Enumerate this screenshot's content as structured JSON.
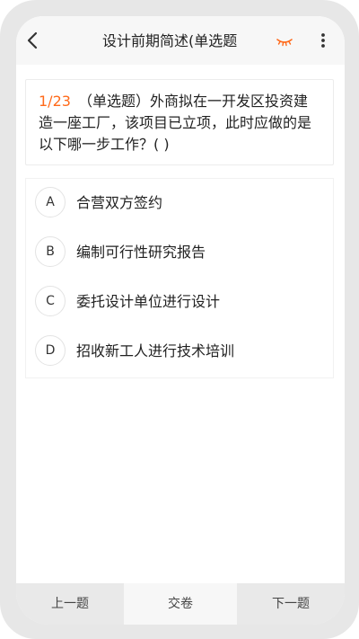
{
  "header": {
    "title": "设计前期简述(单选题",
    "back_icon": "chevron-left-icon",
    "eye_icon": "closed-eye-icon",
    "more_icon": "vertical-ellipsis-icon"
  },
  "question": {
    "index": "1/23",
    "text": "（单选题）外商拟在一开发区投资建造一座工厂，该项目已立项，此时应做的是以下哪一步工作？( )"
  },
  "options": [
    {
      "letter": "A",
      "text": "合营双方签约"
    },
    {
      "letter": "B",
      "text": "编制可行性研究报告"
    },
    {
      "letter": "C",
      "text": "委托设计单位进行设计"
    },
    {
      "letter": "D",
      "text": "招收新工人进行技术培训"
    }
  ],
  "footer": {
    "prev_label": "上一题",
    "submit_label": "交卷",
    "next_label": "下一题"
  },
  "colors": {
    "accent": "#ff6a1a",
    "frame": "#e7e7e7",
    "bar": "#f7f7f7"
  }
}
